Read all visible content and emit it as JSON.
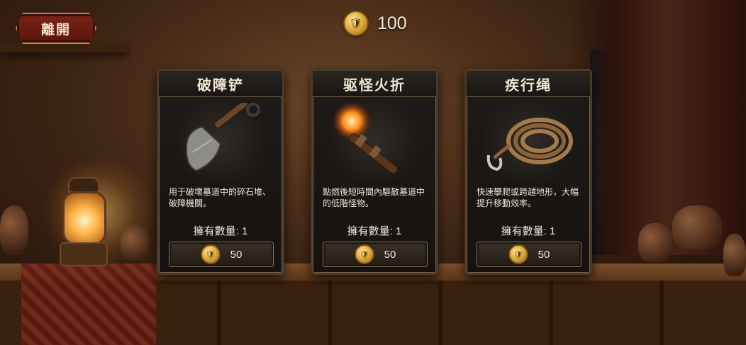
{
  "topbar": {
    "leave_label": "離開",
    "currency_amount": "100"
  },
  "shop": {
    "items": [
      {
        "name": "破障铲",
        "description": "用于破壞墓道中的碎石堆、破障機關。",
        "owned": "擁有數量: 1",
        "price": "50",
        "icon": "shovel-icon"
      },
      {
        "name": "驱怪火折",
        "description": "點燃後短時間內驅散墓道中的低階怪物。",
        "owned": "擁有數量: 1",
        "price": "50",
        "icon": "torch-icon"
      },
      {
        "name": "疾行绳",
        "description": "快速攀爬或跨越地形，大幅提升移動效率。",
        "owned": "擁有數量: 1",
        "price": "50",
        "icon": "rope-icon"
      }
    ]
  },
  "colors": {
    "gold": "#e8b545",
    "leave_button": "#7b2418",
    "card_border": "#4b3a2a"
  }
}
